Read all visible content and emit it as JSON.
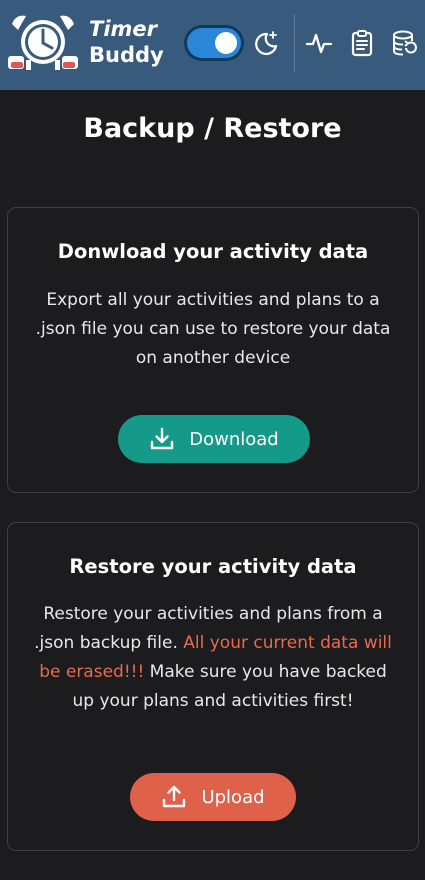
{
  "header": {
    "app_name_line1": "Timer",
    "app_name_line2": "Buddy",
    "icons": [
      "alarm-clock-logo",
      "moon-icon",
      "activity-icon",
      "clipboard-icon",
      "database-restore-icon"
    ],
    "dark_mode_toggle": true
  },
  "page": {
    "title": "Backup / Restore"
  },
  "download_card": {
    "title": "Donwload your activity data",
    "description": "Export all your activities and plans to a .json file you can use to restore your data on another device",
    "button_label": "Download"
  },
  "upload_card": {
    "title": "Restore your activity data",
    "description_part1": "Restore your activities and plans from a .json backup file. ",
    "warning": "All your current data will be erased!!!",
    "description_part2": " Make sure you have backed up your plans and activities first!",
    "button_label": "Upload"
  },
  "colors": {
    "header_bg": "#385a7c",
    "page_bg": "#1c1b1e",
    "download_button": "#159a8a",
    "upload_button": "#e0614a",
    "warning_text": "#e8694f"
  }
}
